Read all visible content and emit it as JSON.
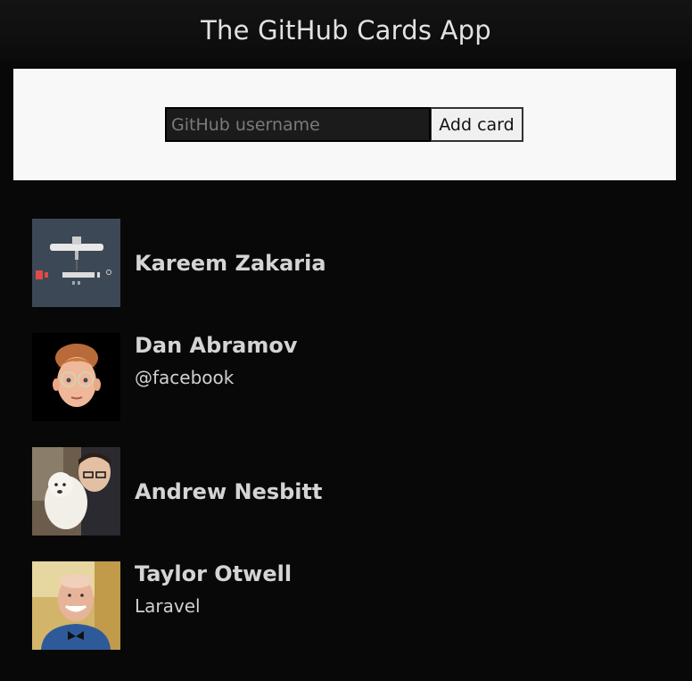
{
  "header": {
    "title": "The GitHub Cards App"
  },
  "form": {
    "username_placeholder": "GitHub username",
    "username_value": "",
    "add_label": "Add card"
  },
  "cards": [
    {
      "name": "Kareem Zakaria",
      "company": "",
      "avatar_icon": "desk-setup-illustration"
    },
    {
      "name": "Dan Abramov",
      "company": "@facebook",
      "avatar_icon": "memoji-face"
    },
    {
      "name": "Andrew Nesbitt",
      "company": "",
      "avatar_icon": "person-with-dog-photo"
    },
    {
      "name": "Taylor Otwell",
      "company": "Laravel",
      "avatar_icon": "smiling-man-photo"
    }
  ],
  "colors": {
    "background": "#080808",
    "panel": "#f8f8f8",
    "text": "#d8d8d8"
  }
}
